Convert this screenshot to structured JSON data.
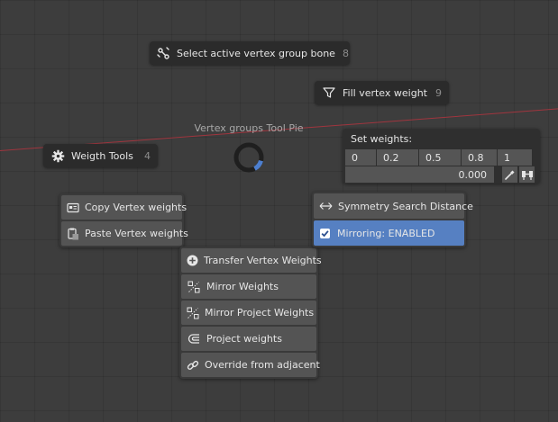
{
  "pie": {
    "title": "Vertex groups Tool Pie",
    "select_bone": {
      "label": "Select active vertex group bone",
      "key": "8",
      "icon": "bone-select-icon"
    },
    "fill_weight": {
      "label": "Fill vertex weight",
      "key": "9",
      "icon": "filter-icon"
    },
    "weigth_tools": {
      "label": "Weigth Tools",
      "key": "4",
      "icon": "gear-icon"
    }
  },
  "copy_paste": [
    {
      "label": "Copy Vertex weights",
      "icon": "copy-weights-icon"
    },
    {
      "label": "Paste Vertex weights",
      "icon": "paste-weights-icon"
    }
  ],
  "tools": [
    {
      "label": "Transfer Vertex Weights",
      "icon": "plus-circle-icon"
    },
    {
      "label": "Mirror Weights",
      "icon": "mirror-icon"
    },
    {
      "label": "Mirror Project Weights",
      "icon": "mirror-project-icon"
    },
    {
      "label": "Project weights",
      "icon": "project-icon"
    },
    {
      "label": "Override from adjacent",
      "icon": "link-icon"
    }
  ],
  "weights": {
    "title": "Set weights:",
    "presets": [
      "0",
      "0.2",
      "0.5",
      "0.8",
      "1"
    ],
    "value": "0.000",
    "eyedropper_icon": "eyedropper-icon",
    "paint_icon": "weight-paint-icon"
  },
  "symmetry": {
    "search_distance": {
      "label": "Symmetry Search Distance",
      "icon": "arrows-horizontal-icon"
    },
    "mirroring": {
      "label": "Mirroring: ENABLED",
      "checked": true
    }
  },
  "colors": {
    "accent": "#5680c2",
    "ring": "#4d7fcf",
    "axis": "#a0353e"
  }
}
